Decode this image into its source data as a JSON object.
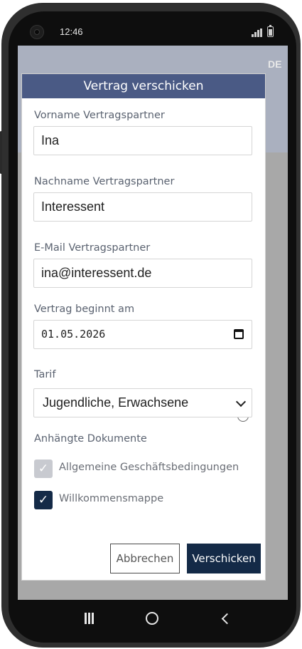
{
  "status_bar": {
    "time": "12:46"
  },
  "dialog": {
    "title": "Vertrag verschicken",
    "first_name": {
      "label": "Vorname Vertragspartner",
      "value": "Ina"
    },
    "last_name": {
      "label": "Nachname Vertragspartner",
      "value": "Interessent"
    },
    "email": {
      "label": "E-Mail Vertragspartner",
      "value": "ina@interessent.de"
    },
    "start_date": {
      "label": "Vertrag beginnt am",
      "value": "01.05.2026"
    },
    "tariff": {
      "label": "Tarif",
      "selected": "Jugendliche, Erwachsene",
      "info_icon": "info-icon"
    },
    "documents": {
      "heading": "Anhängte Dokumente",
      "items": [
        {
          "label": "Allgemeine Geschäftsbedingungen",
          "checked": true,
          "disabled": true
        },
        {
          "label": "Willkommensmappe",
          "checked": true,
          "disabled": false
        }
      ]
    },
    "buttons": {
      "cancel": "Abbrechen",
      "send": "Verschicken"
    }
  },
  "background": {
    "partial_text": "DE"
  },
  "nav_bar": {
    "icons": [
      "recents-icon",
      "home-icon",
      "back-icon"
    ]
  },
  "colors": {
    "dialog_header": "#4a5a85",
    "primary": "#142a47",
    "checkbox_disabled": "#c8cad0"
  }
}
